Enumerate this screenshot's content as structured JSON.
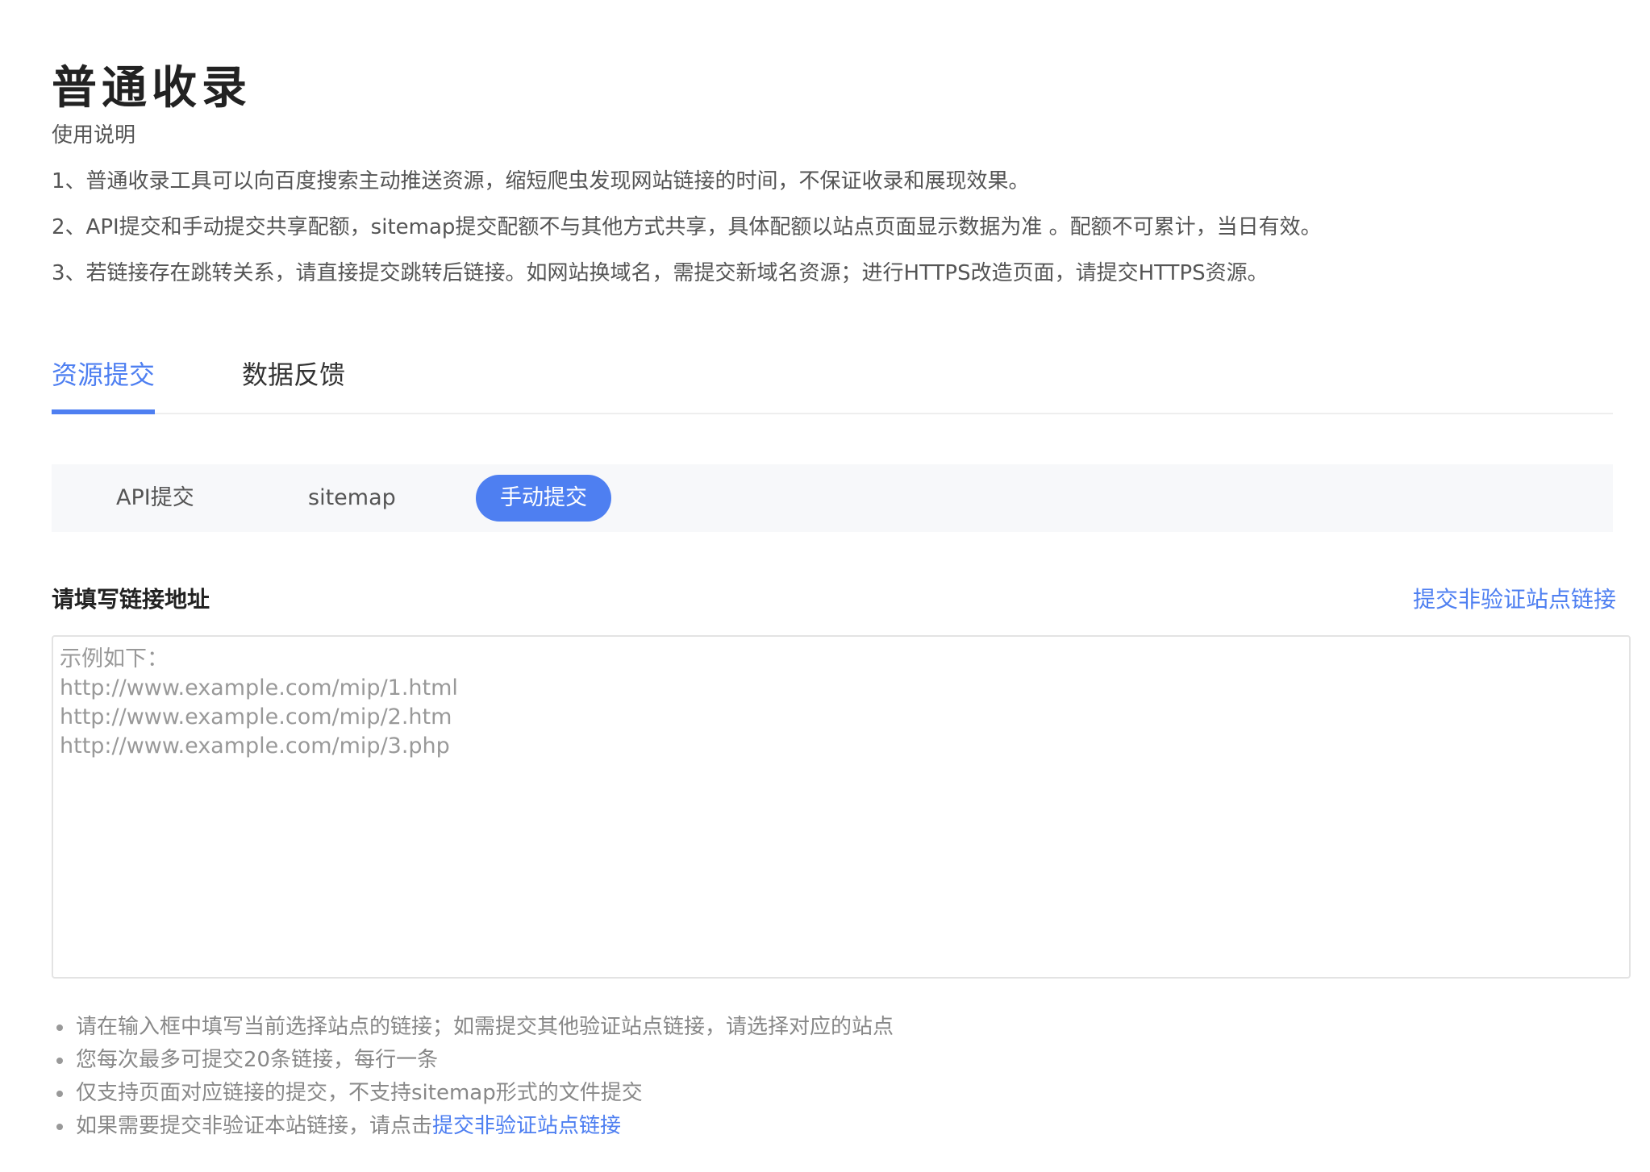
{
  "page": {
    "title": "普通收录"
  },
  "instructions": {
    "heading": "使用说明",
    "lines": [
      "1、普通收录工具可以向百度搜索主动推送资源，缩短爬虫发现网站链接的时间，不保证收录和展现效果。",
      "2、API提交和手动提交共享配额，sitemap提交配额不与其他方式共享，具体配额以站点页面显示数据为准 。配额不可累计，当日有效。",
      "3、若链接存在跳转关系，请直接提交跳转后链接。如网站换域名，需提交新域名资源；进行HTTPS改造页面，请提交HTTPS资源。"
    ]
  },
  "tabs": [
    {
      "label": "资源提交",
      "active": true
    },
    {
      "label": "数据反馈",
      "active": false
    }
  ],
  "subtabs": [
    {
      "label": "API提交",
      "selected": false
    },
    {
      "label": "sitemap",
      "selected": false
    },
    {
      "label": "手动提交",
      "selected": true
    }
  ],
  "form": {
    "label": "请填写链接地址",
    "link": "提交非验证站点链接",
    "value": "",
    "placeholder": "示例如下：\nhttp://www.example.com/mip/1.html\nhttp://www.example.com/mip/2.htm\nhttp://www.example.com/mip/3.php"
  },
  "tips": [
    "请在输入框中填写当前选择站点的链接；如需提交其他验证站点链接，请选择对应的站点",
    "您每次最多可提交20条链接，每行一条",
    "仅支持页面对应链接的提交，不支持sitemap形式的文件提交"
  ],
  "last_tip": {
    "prefix": "如果需要提交非验证本站链接，请点击",
    "link": "提交非验证站点链接"
  },
  "colors": {
    "accent": "#4e7ff1",
    "text": "#333333",
    "muted": "#888888",
    "subtab_bg": "#f7f8fa"
  }
}
